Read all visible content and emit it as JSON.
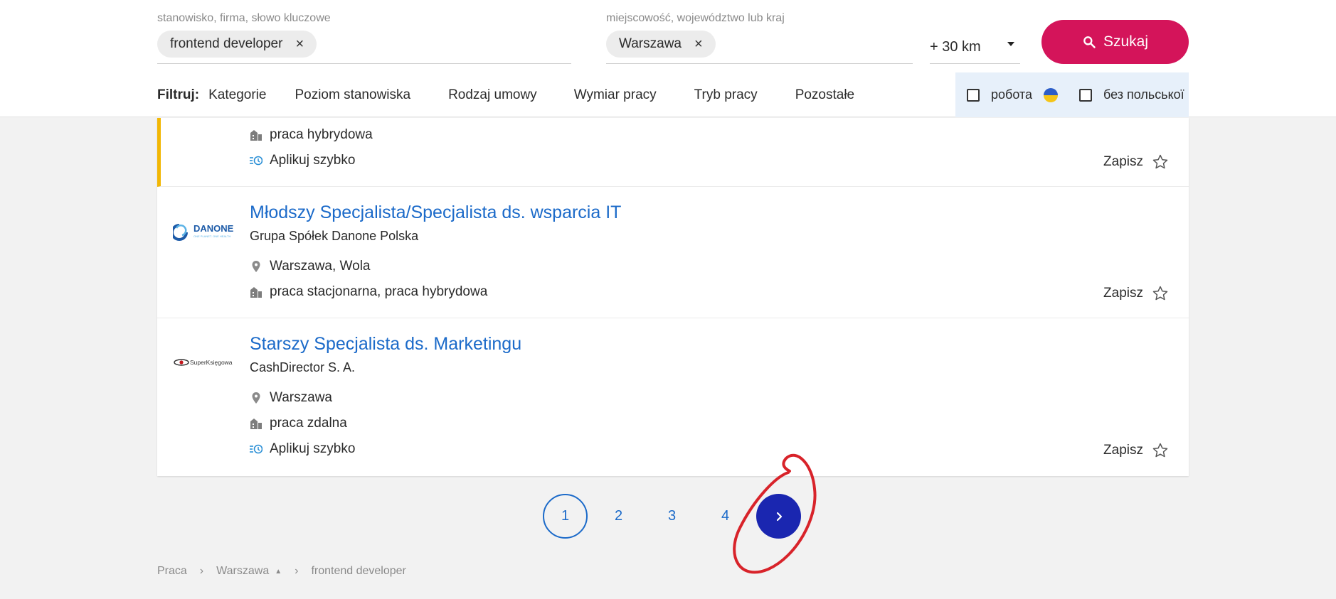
{
  "search": {
    "keyword_label": "stanowisko, firma, słowo kluczowe",
    "keyword_chip": "frontend developer",
    "location_label": "miejscowość, województwo lub kraj",
    "location_chip": "Warszawa",
    "chip_remove": "×",
    "radius": "+ 30 km",
    "button": "Szukaj"
  },
  "filters": {
    "label": "Filtruj:",
    "items": [
      "Kategorie",
      "Poziom stanowiska",
      "Rodzaj umowy",
      "Wymiar pracy",
      "Tryb pracy",
      "Pozostałe"
    ],
    "ua_checkbox": "робота",
    "no_polish_checkbox": "без польської"
  },
  "jobs": [
    {
      "work_mode": "praca hybrydowa",
      "quick_apply": "Aplikuj szybko",
      "save": "Zapisz"
    },
    {
      "title": "Młodszy Specjalista/Specjalista ds. wsparcia IT",
      "company": "Grupa Spółek Danone Polska",
      "logo_text": "DANONE",
      "logo_tagline": "ONE PLANET. ONE HEALTH",
      "location": "Warszawa, Wola",
      "work_mode": "praca stacjonarna, praca hybrydowa",
      "save": "Zapisz"
    },
    {
      "title": "Starszy Specjalista ds. Marketingu",
      "company": "CashDirector S. A.",
      "logo_text": "SuperKsięgowa",
      "location": "Warszawa",
      "work_mode": "praca zdalna",
      "quick_apply": "Aplikuj szybko",
      "save": "Zapisz"
    }
  ],
  "pagination": {
    "pages": [
      "1",
      "2",
      "3",
      "4"
    ],
    "current": "1",
    "next_icon": "chevron-right-icon"
  },
  "breadcrumb": {
    "items": [
      "Praca",
      "Warszawa",
      "frontend developer"
    ],
    "separator": "›"
  },
  "colors": {
    "accent": "#d4145a",
    "link": "#1b6ac9",
    "next_button": "#1a26b0",
    "highlight_bar": "#f2b705",
    "annotation": "#d8232a"
  }
}
